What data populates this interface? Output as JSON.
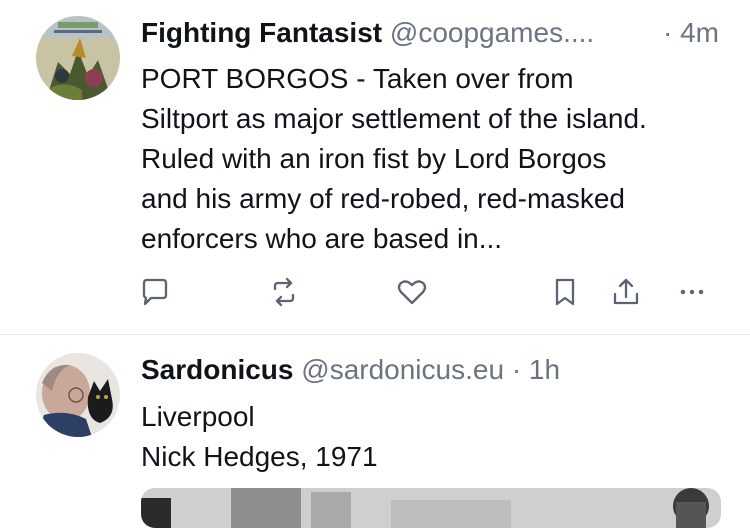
{
  "posts": [
    {
      "author_name": "Fighting Fantasist",
      "handle": "@coopgames....",
      "time": "· 4m",
      "avatar_icon": "book-cover-avatar-icon",
      "body_lines": [
        "PORT BORGOS - Taken over from",
        "Siltport as major settlement of the island.",
        "Ruled with an iron fist by Lord Borgos",
        "and his army of red-robed, red-masked",
        "enforcers who are based in..."
      ],
      "actions": [
        "reply-icon",
        "repost-icon",
        "like-icon",
        "bookmark-icon",
        "share-icon",
        "more-icon"
      ]
    },
    {
      "author_name": "Sardonicus",
      "handle": "@sardonicus.eu",
      "time": "· 1h",
      "avatar_icon": "man-with-cat-avatar-icon",
      "body_lines": [
        "Liverpool",
        "Nick Hedges, 1971"
      ]
    }
  ],
  "colors": {
    "text": "#0f1419",
    "muted": "#6b7480",
    "icon": "#5b6470",
    "divider": "#e6e8ea"
  }
}
